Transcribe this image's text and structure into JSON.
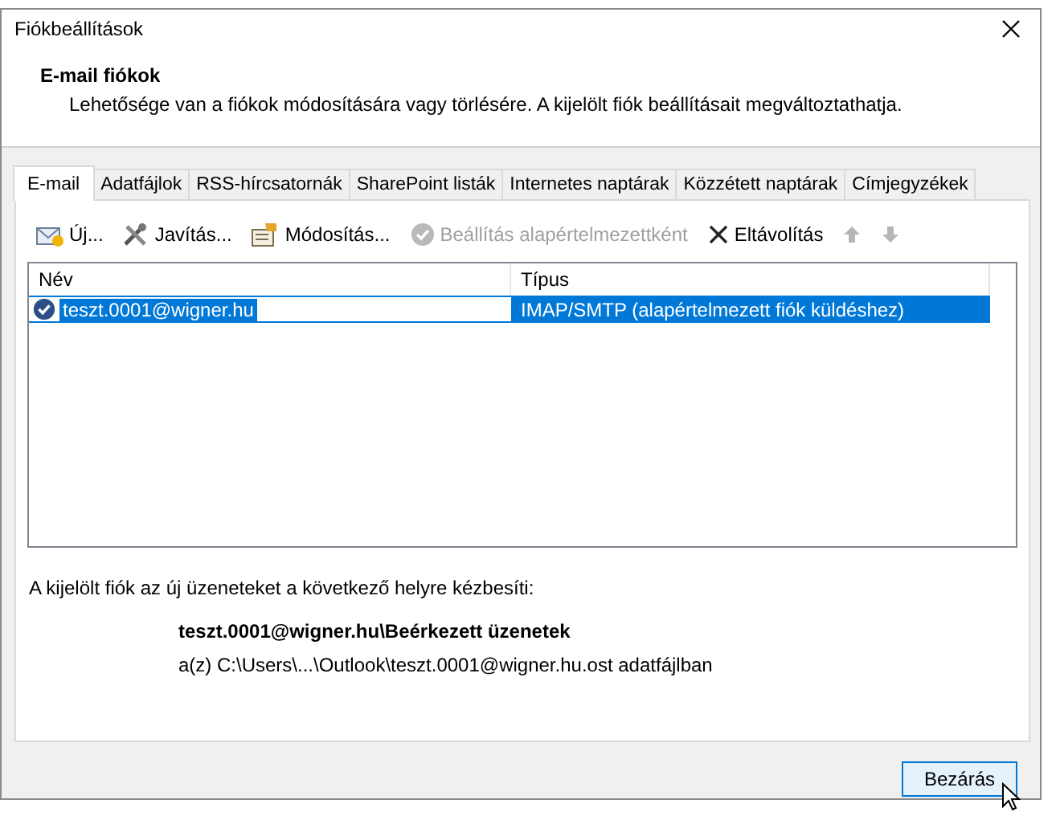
{
  "window": {
    "title": "Fiókbeállítások"
  },
  "header": {
    "title": "E-mail fiókok",
    "description": "Lehetősége van a fiókok módosítására vagy törlésére. A kijelölt fiók beállításait megváltoztathatja."
  },
  "tabs": [
    {
      "label": "E-mail",
      "selected": true
    },
    {
      "label": "Adatfájlok",
      "selected": false
    },
    {
      "label": "RSS-hírcsatornák",
      "selected": false
    },
    {
      "label": "SharePoint listák",
      "selected": false
    },
    {
      "label": "Internetes naptárak",
      "selected": false
    },
    {
      "label": "Közzétett naptárak",
      "selected": false
    },
    {
      "label": "Címjegyzékek",
      "selected": false
    }
  ],
  "toolbar": [
    {
      "kind": "new",
      "label": "Új...",
      "disabled": false
    },
    {
      "kind": "repair",
      "label": "Javítás...",
      "disabled": false
    },
    {
      "kind": "change",
      "label": "Módosítás...",
      "disabled": false
    },
    {
      "kind": "default",
      "label": "Beállítás alapértelmezettként",
      "disabled": true
    },
    {
      "kind": "remove",
      "label": "Eltávolítás",
      "disabled": false
    },
    {
      "kind": "up",
      "disabled": true
    },
    {
      "kind": "down",
      "disabled": true
    }
  ],
  "table": {
    "columns": [
      "Név",
      "Típus"
    ],
    "rows": [
      {
        "name": "teszt.0001@wigner.hu",
        "type": "IMAP/SMTP (alapértelmezett fiók küldéshez)",
        "selected": true,
        "default": true
      }
    ]
  },
  "delivery": {
    "label": "A kijelölt fiók az új üzeneteket a következő helyre kézbesíti:",
    "folder": "teszt.0001@wigner.hu\\Beérkezett üzenetek",
    "file": "a(z) C:\\Users\\...\\Outlook\\teszt.0001@wigner.hu.ost adatfájlban"
  },
  "buttons": [
    "Bezárás"
  ]
}
